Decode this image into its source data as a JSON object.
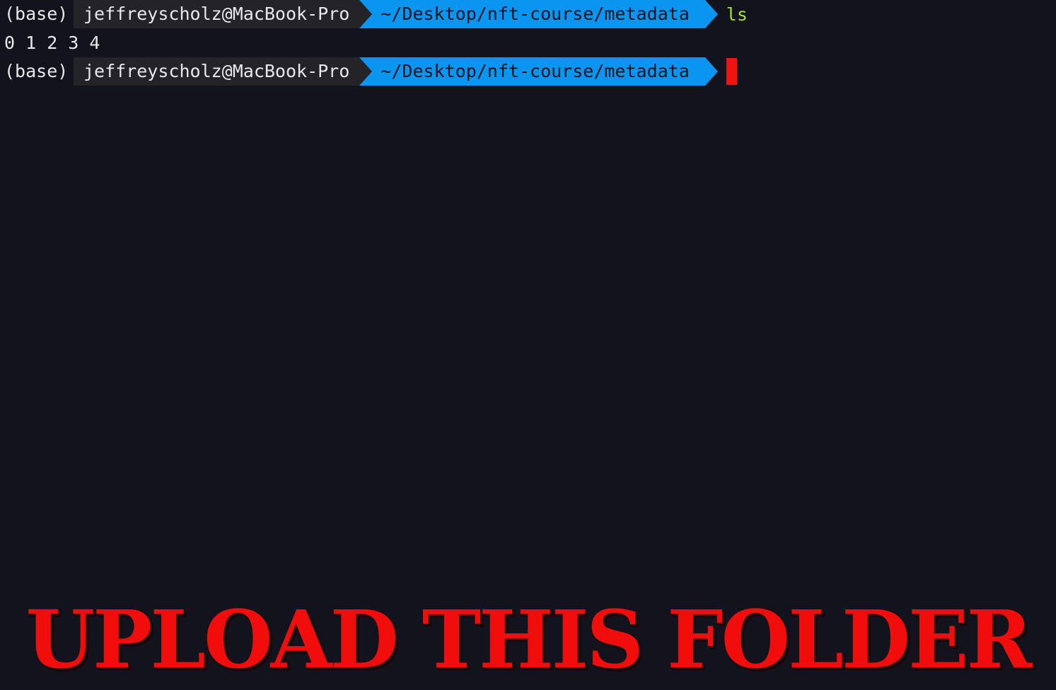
{
  "terminal": {
    "lines": [
      {
        "env": "(base)",
        "user_host": "jeffreyscholz@MacBook-Pro",
        "path": "~/Desktop/nft-course/metadata",
        "command": "ls"
      },
      {
        "output": "0 1 2 3 4"
      },
      {
        "env": "(base)",
        "user_host": "jeffreyscholz@MacBook-Pro",
        "path": "~/Desktop/nft-course/metadata",
        "command": ""
      }
    ]
  },
  "caption": {
    "text": "UPLOAD THIS FOLDER"
  },
  "colors": {
    "background": "#13131d",
    "path_segment": "#0a96f0",
    "user_segment": "#232328",
    "command": "#a6e22e",
    "cursor": "#f2140c",
    "caption": "#f20d0d"
  }
}
